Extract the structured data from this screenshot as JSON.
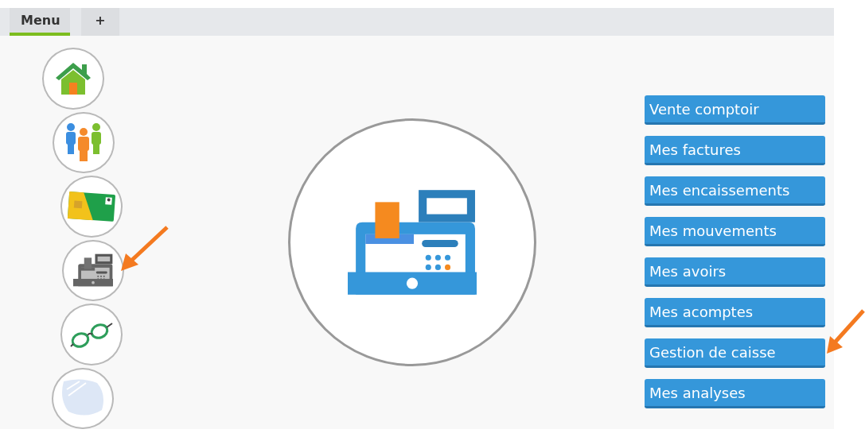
{
  "tabs": [
    {
      "label": "Menu",
      "selected": true
    },
    {
      "label": "+",
      "selected": false
    }
  ],
  "sidebar": {
    "items": [
      {
        "kind": "home",
        "selected": false
      },
      {
        "kind": "people",
        "selected": false
      },
      {
        "kind": "card",
        "selected": false
      },
      {
        "kind": "register",
        "selected": true
      },
      {
        "kind": "glasses",
        "selected": false
      },
      {
        "kind": "lens",
        "selected": false
      }
    ]
  },
  "main": {
    "kind": "register"
  },
  "actions": [
    {
      "label": "Vente comptoir"
    },
    {
      "label": "Mes factures"
    },
    {
      "label": "Mes encaissements"
    },
    {
      "label": "Mes mouvements"
    },
    {
      "label": "Mes avoirs"
    },
    {
      "label": "Mes acomptes"
    },
    {
      "label": "Gestion de caisse"
    },
    {
      "label": "Mes analyses"
    }
  ]
}
